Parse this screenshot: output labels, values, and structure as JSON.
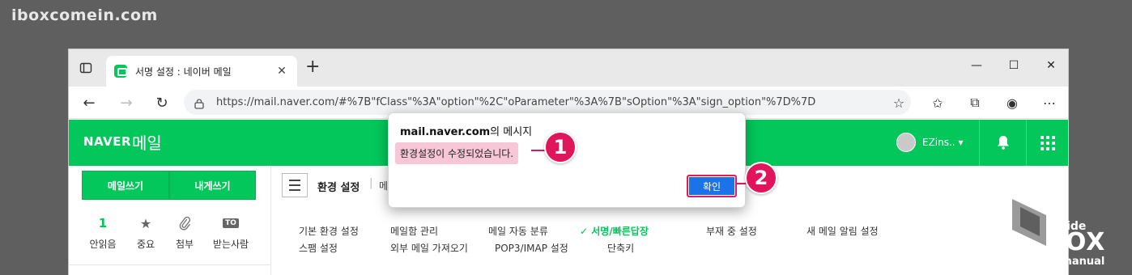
{
  "watermark": {
    "site": "iboxcomein.com"
  },
  "browser": {
    "tab_title": "서명 설정 : 네이버 메일",
    "new_tab": "+",
    "url": "https://mail.naver.com/#%7B\"fClass\"%3A\"option\"%2C\"oParameter\"%3A%7B\"sOption\"%3A\"sign_option\"%7D%7D"
  },
  "naver": {
    "logo": "NAVER",
    "service": "메일",
    "user_name": "EZins.. ▾"
  },
  "sidebar": {
    "compose_label": "메일쓰기",
    "self_label": "내게쓰기",
    "quick": [
      {
        "icon": "unread-count",
        "value": "1",
        "label": "안읽음"
      },
      {
        "icon": "star-icon",
        "value": "★",
        "label": "중요"
      },
      {
        "icon": "paperclip-icon",
        "value": "📎",
        "label": "첨부"
      },
      {
        "icon": "to-icon",
        "value": "TO",
        "label": "받는사람"
      }
    ]
  },
  "main": {
    "page_title": "환경 설정",
    "crumb_sep": "|",
    "crumb_next": "메",
    "settings": [
      {
        "label": "기본 환경 설정",
        "active": false
      },
      {
        "label": "메일함 관리",
        "active": false
      },
      {
        "label": "메일 자동 분류",
        "active": false
      },
      {
        "label": "✓ 서명/빠른답장",
        "active": true
      },
      {
        "label": "부재 중 설정",
        "active": false
      },
      {
        "label": "새 메일 알림 설정",
        "active": false
      },
      {
        "label": "스팸 설정",
        "active": false
      },
      {
        "label": "외부 메일 가져오기",
        "active": false
      },
      {
        "label": "POP3/IMAP 설정",
        "active": false
      },
      {
        "label": "단축키",
        "active": false
      }
    ]
  },
  "dialog": {
    "title_domain": "mail.naver.com",
    "title_rest": "의 메시지",
    "message": "환경설정이 수정되었습니다.",
    "ok_label": "확인"
  },
  "callouts": {
    "one": "1",
    "two": "2"
  },
  "brand": {
    "inside": "inside",
    "box": "BOX",
    "ez": "EZmanual"
  },
  "colors": {
    "naver_green": "#03c75a",
    "accent_pink": "#e0155c",
    "highlight": "#f7c7d7",
    "ok_blue": "#1a73e8"
  }
}
